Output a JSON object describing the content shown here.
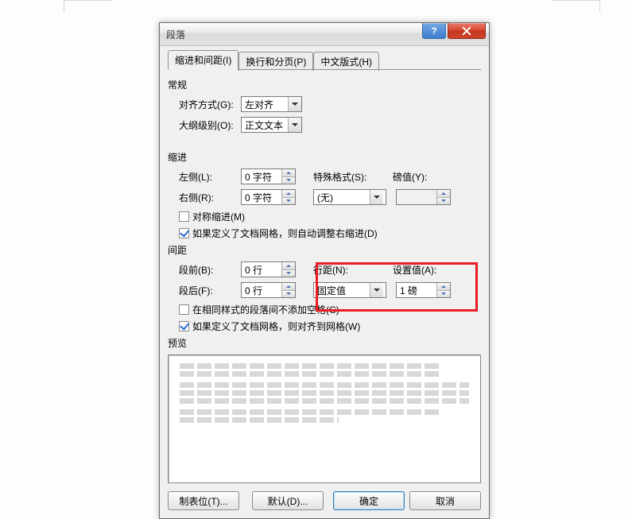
{
  "title": "段落",
  "tabs": {
    "t0": "缩进和间距(I)",
    "t1": "换行和分页(P)",
    "t2": "中文版式(H)"
  },
  "general": {
    "heading": "常规",
    "align_label": "对齐方式(G):",
    "align_value": "左对齐",
    "outline_label": "大纲级别(O):",
    "outline_value": "正文文本"
  },
  "indent": {
    "heading": "缩进",
    "left_label": "左侧(L):",
    "left_value": "0 字符",
    "right_label": "右侧(R):",
    "right_value": "0 字符",
    "special_label": "特殊格式(S):",
    "special_value": "(无)",
    "pounds_label": "磅值(Y):",
    "mirror_label": "对称缩进(M)",
    "autogrid_label": "如果定义了文档网格，则自动调整右缩进(D)"
  },
  "spacing": {
    "heading": "间距",
    "before_label": "段前(B):",
    "before_value": "0 行",
    "after_label": "段后(F):",
    "after_value": "0 行",
    "line_label": "行距(N):",
    "line_value": "固定值",
    "set_label": "设置值(A):",
    "set_value": "1 磅",
    "nosame_label": "在相同样式的段落间不添加空格(C)",
    "snap_label": "如果定义了文档网格，则对齐到网格(W)"
  },
  "preview_heading": "预览",
  "buttons": {
    "tabs": "制表位(T)...",
    "default": "默认(D)...",
    "ok": "确定",
    "cancel": "取消"
  },
  "win": {
    "help": "?",
    "close": "x"
  }
}
